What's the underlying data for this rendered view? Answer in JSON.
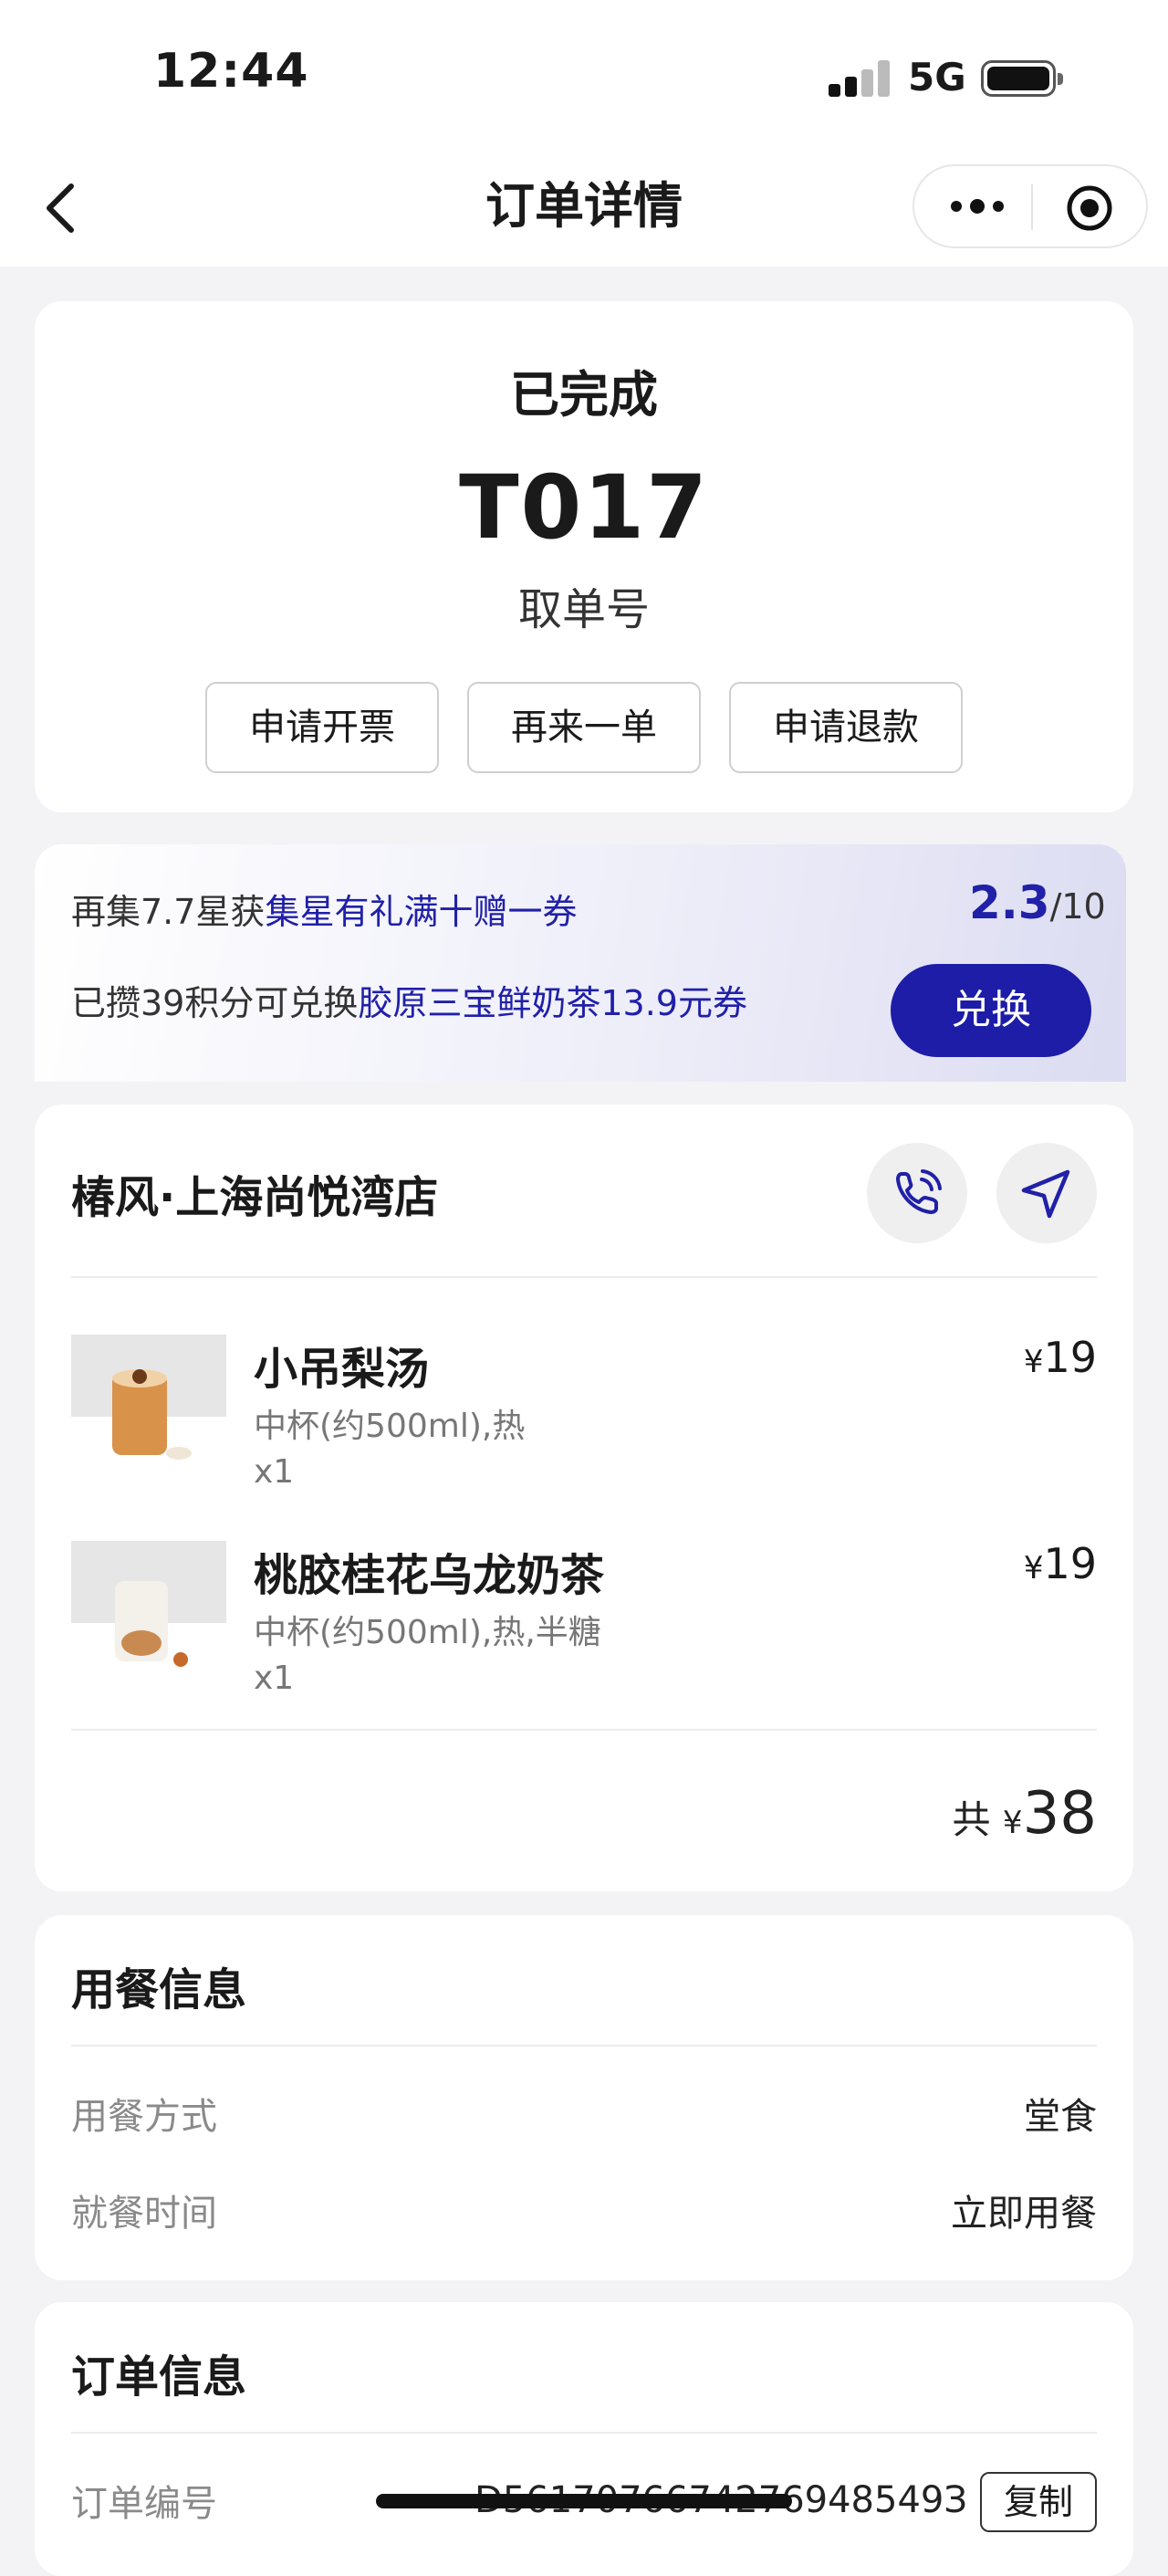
{
  "status_bar": {
    "time": "12:44",
    "network": "5G"
  },
  "nav": {
    "title": "订单详情"
  },
  "order_status": {
    "status": "已完成",
    "pickup_number": "T017",
    "pickup_label": "取单号",
    "actions": [
      "申请开票",
      "再来一单",
      "申请退款"
    ]
  },
  "promo": {
    "line1_prefix": "再集7.7星获",
    "line1_highlight": "集星有礼满十赠一券",
    "progress_current": "2.3",
    "progress_total": "/10",
    "line2_prefix": "已攒39积分可兑换",
    "line2_highlight": "胶原三宝鲜奶茶13.9元券",
    "redeem_label": "兑换",
    "accent_color": "#1d1da8"
  },
  "store": {
    "name": "椿风·上海尚悦湾店",
    "icons": [
      "phone-icon",
      "navigate-icon"
    ]
  },
  "items": [
    {
      "name": "小吊梨汤",
      "spec": "中杯(约500ml),热",
      "qty": "x1",
      "currency": "¥",
      "price": "19"
    },
    {
      "name": "桃胶桂花乌龙奶茶",
      "spec": "中杯(约500ml),热,半糖",
      "qty": "x1",
      "currency": "¥",
      "price": "19"
    }
  ],
  "total": {
    "prefix": "共",
    "currency": "¥",
    "amount": "38"
  },
  "dining_info": {
    "title": "用餐信息",
    "rows": [
      {
        "label": "用餐方式",
        "value": "堂食"
      },
      {
        "label": "就餐时间",
        "value": "立即用餐"
      }
    ]
  },
  "order_info": {
    "title": "订单信息",
    "rows": [
      {
        "label": "订单编号",
        "value": "D5617076674276948549З",
        "action": "复制"
      }
    ]
  }
}
